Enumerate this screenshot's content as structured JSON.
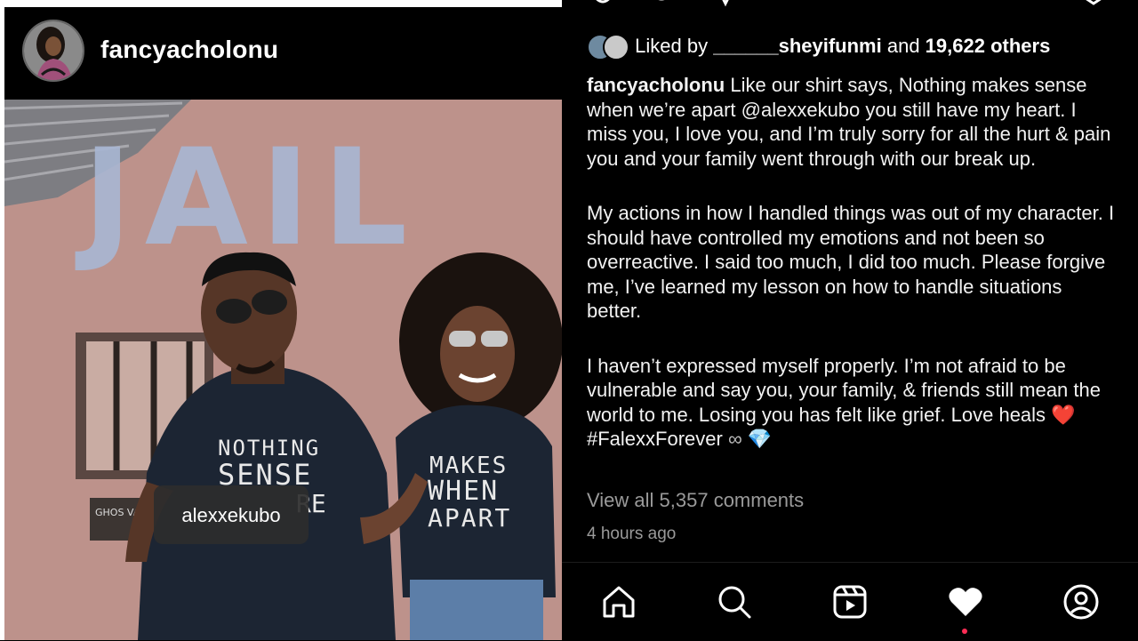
{
  "post": {
    "username": "fancyacholonu",
    "tag_label": "alexxekubo",
    "photo_text": {
      "wall_sign": "JAIL",
      "shirt_left_line1": "NOTHING",
      "shirt_left_line2": "SENSE",
      "shirt_left_line3": "RE",
      "shirt_right_line1": "MAKES",
      "shirt_right_line2": "WHEN",
      "shirt_right_line3": "APART",
      "plaque": "GHOS VAR"
    }
  },
  "likes": {
    "prefix": "Liked by ",
    "liker": "______sheyifunmi",
    "middle": " and ",
    "count": "19,622 others"
  },
  "caption": {
    "user": "fancyacholonu",
    "para1": " Like our shirt says, Nothing makes sense when we’re apart @alexxekubo you still have my heart. I miss you, I love you, and I’m truly sorry for all the hurt & pain you and your family went through with our break up.",
    "para2": "My actions in how I handled things was out of my character. I should have controlled my emotions and not been so overreactive. I said too much, I did too much. Please forgive me, I’ve learned my lesson on how to handle situations better.",
    "para3": "I haven’t expressed myself properly. I’m not afraid to be vulnerable and say you, your family, & friends still mean the world to me. Losing you has felt like grief. Love heals ",
    "heart_emoji": "❤️",
    "hashtag": " #FalexxForever ",
    "infinity": "∞",
    "gem": "💎"
  },
  "comments_link": "View all 5,357 comments",
  "timestamp": "4 hours ago",
  "nav": {
    "home": "home-icon",
    "search": "search-icon",
    "reels": "reels-icon",
    "activity": "heart-icon",
    "profile": "profile-icon"
  },
  "colors": {
    "background": "#000000",
    "heart": "#e0245e",
    "gem": "#5fb8f0",
    "notification_dot": "#ff2d55",
    "muted_text": "#9a9a9a"
  }
}
